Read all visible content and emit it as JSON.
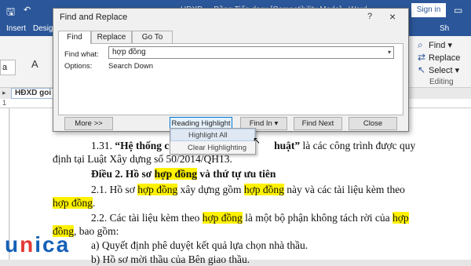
{
  "word": {
    "title": "HDXD ...   Đồng Tiến.docx [Compatibility Mode] - Word",
    "sign_in": "Sign in",
    "tabs": [
      "Insert",
      "Design"
    ],
    "share": "Sh",
    "font_combo": "a",
    "aa": "A",
    "editing": {
      "find": "Find",
      "replace": "Replace",
      "select": "Select",
      "group_label": "Editing"
    },
    "nav_tab": "HĐXD goi",
    "ruler_marker": "1"
  },
  "dialog": {
    "title": "Find and Replace",
    "help": "?",
    "close": "×",
    "tabs": [
      "Find",
      "Replace",
      "Go To"
    ],
    "find_what_label": "Find what:",
    "find_what_value": "hợp đồng",
    "options_label": "Options:",
    "options_value": "Search Down",
    "buttons": {
      "more": "More >>",
      "reading_highlight": "Reading Highlight ▾",
      "find_in": "Find In ▾",
      "find_next": "Find Next",
      "close": "Close"
    },
    "menu": [
      "Highlight All",
      "Clear Highlighting"
    ]
  },
  "document": {
    "l1a": "1.31. ",
    "l1b": "“Hệ thống cô",
    "l1c": "huật”",
    "l1d": " là các công trình được quy",
    "l2": "định tại Luật Xây dựng số 50/2014/QH13.",
    "l3a": "Điều 2. Hồ sơ ",
    "l3b": "hợp đồng",
    "l3c": " và thứ tự ưu tiên",
    "l4a": "2.1. Hồ sơ ",
    "l4b": "hợp đồng",
    "l4c": " xây dựng gồm ",
    "l4d": "hợp đồng",
    "l4e": " này và các tài liệu kèm theo",
    "l5a": "hợp đồng",
    "l5b": ".",
    "l6a": "2.2. Các tài liệu kèm theo ",
    "l6b": "hợp đồng",
    "l6c": " là một bộ phận không tách rời của ",
    "l6d": "hợp",
    "l7a": "đồng",
    "l7b": ", bao gồm:",
    "l8": "a) Quyết định phê duyệt kết quả lựa chọn nhà thầu.",
    "l9": "b) Hồ sơ mời thầu của Bên giao thầu."
  },
  "watermark": {
    "main": "unica"
  },
  "colors": {
    "word_blue": "#2b579a",
    "highlight": "#fff200",
    "unica_blue": "#1560b8",
    "unica_red": "#e53935"
  }
}
